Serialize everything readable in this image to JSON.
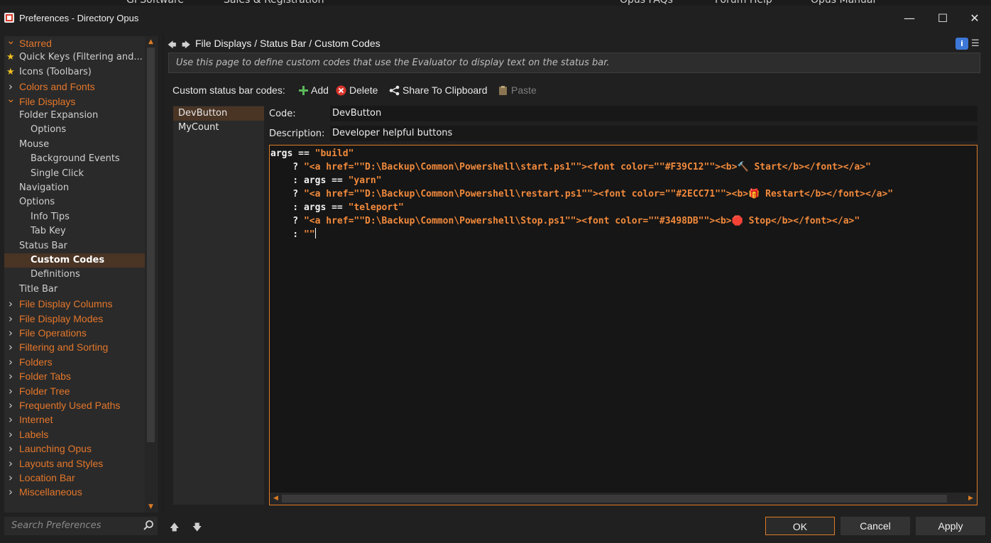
{
  "background_menu": [
    "GPSoftware",
    "Sales & Registration",
    "Opus FAQs",
    "Forum Help",
    "Opus Manual"
  ],
  "window": {
    "title": "Preferences - Directory Opus",
    "minimize": "—",
    "maximize": "☐",
    "close": "✕"
  },
  "tree": {
    "items": [
      {
        "label": "Starred",
        "kind": "cat",
        "icon": "chevron-down",
        "level": 0
      },
      {
        "label": "Quick Keys (Filtering and...",
        "kind": "sub-star",
        "icon": "star",
        "level": 0
      },
      {
        "label": "Icons (Toolbars)",
        "kind": "sub-star",
        "icon": "star",
        "level": 0
      },
      {
        "label": "Colors and Fonts",
        "kind": "cat",
        "icon": "chevron-right",
        "level": 0
      },
      {
        "label": "File Displays",
        "kind": "cat",
        "icon": "chevron-down",
        "level": 0
      },
      {
        "label": "Folder Expansion",
        "kind": "sub",
        "level": 1
      },
      {
        "label": "Options",
        "kind": "sub",
        "level": 2
      },
      {
        "label": "Mouse",
        "kind": "sub",
        "level": 1
      },
      {
        "label": "Background Events",
        "kind": "sub",
        "level": 2
      },
      {
        "label": "Single Click",
        "kind": "sub",
        "level": 2
      },
      {
        "label": "Navigation",
        "kind": "sub",
        "level": 1
      },
      {
        "label": "Options",
        "kind": "sub",
        "level": 1
      },
      {
        "label": "Info Tips",
        "kind": "sub",
        "level": 2
      },
      {
        "label": "Tab Key",
        "kind": "sub",
        "level": 2
      },
      {
        "label": "Status Bar",
        "kind": "sub",
        "level": 1
      },
      {
        "label": "Custom Codes",
        "kind": "sub",
        "level": 2,
        "selected": true
      },
      {
        "label": "Definitions",
        "kind": "sub",
        "level": 2
      },
      {
        "label": "Title Bar",
        "kind": "sub",
        "level": 1
      },
      {
        "label": "File Display Columns",
        "kind": "cat",
        "icon": "chevron-right",
        "level": 0
      },
      {
        "label": "File Display Modes",
        "kind": "cat",
        "icon": "chevron-right",
        "level": 0
      },
      {
        "label": "File Operations",
        "kind": "cat",
        "icon": "chevron-right",
        "level": 0
      },
      {
        "label": "Filtering and Sorting",
        "kind": "cat",
        "icon": "chevron-right",
        "level": 0
      },
      {
        "label": "Folders",
        "kind": "cat",
        "icon": "chevron-right",
        "level": 0
      },
      {
        "label": "Folder Tabs",
        "kind": "cat",
        "icon": "chevron-right",
        "level": 0
      },
      {
        "label": "Folder Tree",
        "kind": "cat",
        "icon": "chevron-right",
        "level": 0
      },
      {
        "label": "Frequently Used Paths",
        "kind": "cat",
        "icon": "chevron-right",
        "level": 0
      },
      {
        "label": "Internet",
        "kind": "cat",
        "icon": "chevron-right",
        "level": 0
      },
      {
        "label": "Labels",
        "kind": "cat",
        "icon": "chevron-right",
        "level": 0
      },
      {
        "label": "Launching Opus",
        "kind": "cat",
        "icon": "chevron-right",
        "level": 0
      },
      {
        "label": "Layouts and Styles",
        "kind": "cat",
        "icon": "chevron-right",
        "level": 0
      },
      {
        "label": "Location Bar",
        "kind": "cat",
        "icon": "chevron-right",
        "level": 0
      },
      {
        "label": "Miscellaneous",
        "kind": "cat",
        "icon": "chevron-right",
        "level": 0
      }
    ]
  },
  "search": {
    "placeholder": "Search Preferences"
  },
  "header": {
    "breadcrumb": "File Displays / Status Bar / Custom Codes",
    "description": "Use this page to define custom codes that use the Evaluator to display text on the status bar."
  },
  "toolbar": {
    "label": "Custom status bar codes:",
    "add": "Add",
    "delete": "Delete",
    "share": "Share To Clipboard",
    "paste": "Paste"
  },
  "codes": [
    {
      "name": "DevButton",
      "selected": true
    },
    {
      "name": "MyCount",
      "selected": false
    }
  ],
  "form": {
    "code_label": "Code:",
    "code_value": "DevButton",
    "description_label": "Description:",
    "description_value": "Developer helpful buttons"
  },
  "editor": {
    "lines": [
      "args == \"build\"",
      "    ? \"<a href=\"\"D:\\Backup\\Common\\Powershell\\start.ps1\"\"><font color=\"\"#F39C12\"\"><b>🔨 Start</b></font></a>\"",
      "    : args == \"yarn\"",
      "    ? \"<a href=\"\"D:\\Backup\\Common\\Powershell\\restart.ps1\"\"><font color=\"\"#2ECC71\"\"><b>🎁 Restart</b></font></a>\"",
      "    : args == \"teleport\"",
      "    ? \"<a href=\"\"D:\\Backup\\Common\\Powershell\\Stop.ps1\"\"><font color=\"\"#3498DB\"\"><b>🛑 Stop</b></font></a>\"",
      "    : \"\""
    ]
  },
  "buttons": {
    "ok": "OK",
    "cancel": "Cancel",
    "apply": "Apply"
  },
  "colors": {
    "accent": "#E07B26",
    "selection": "#4A3424",
    "info": "#3D78D8"
  }
}
